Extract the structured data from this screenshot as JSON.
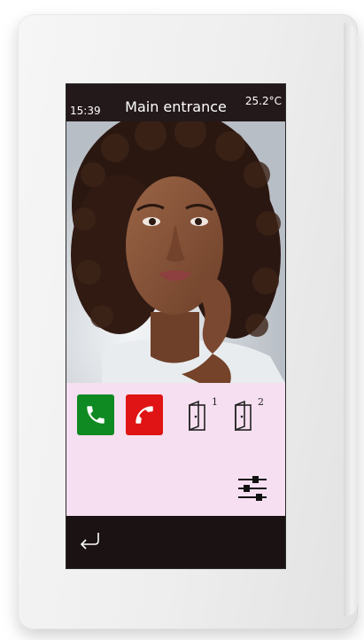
{
  "status_bar": {
    "time": "15:39",
    "title": "Main entrance",
    "temperature": "25.2°C"
  },
  "camera_feed": {
    "description_icon": "camera-view"
  },
  "controls": {
    "accept_call": {
      "icon": "phone-icon",
      "color": "#0f8a22"
    },
    "reject_call": {
      "icon": "phone-hangup-icon",
      "color": "#e01414"
    },
    "doors": [
      {
        "icon": "door-icon",
        "number": "1"
      },
      {
        "icon": "door-icon",
        "number": "2"
      }
    ],
    "settings": {
      "icon": "sliders-icon"
    }
  },
  "bottom_bar": {
    "back": {
      "icon": "back-arrow-icon"
    }
  },
  "colors": {
    "control_background": "#f6dff0",
    "status_bar": "#24191a",
    "bottom_bar": "#1b1214"
  }
}
